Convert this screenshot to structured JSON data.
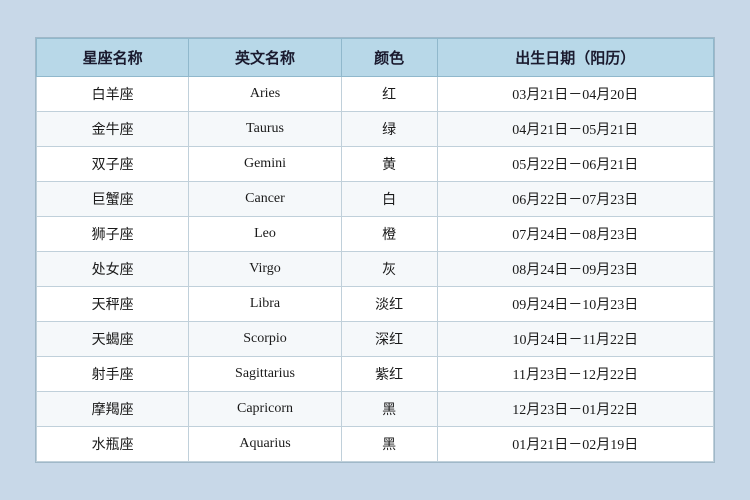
{
  "table": {
    "headers": [
      {
        "key": "chinese_name",
        "label": "星座名称"
      },
      {
        "key": "english_name",
        "label": "英文名称"
      },
      {
        "key": "color",
        "label": "颜色"
      },
      {
        "key": "birthday",
        "label": "出生日期（阳历）"
      }
    ],
    "rows": [
      {
        "chinese_name": "白羊座",
        "english_name": "Aries",
        "color": "红",
        "birthday": "03月21日－04月20日"
      },
      {
        "chinese_name": "金牛座",
        "english_name": "Taurus",
        "color": "绿",
        "birthday": "04月21日－05月21日"
      },
      {
        "chinese_name": "双子座",
        "english_name": "Gemini",
        "color": "黄",
        "birthday": "05月22日－06月21日"
      },
      {
        "chinese_name": "巨蟹座",
        "english_name": "Cancer",
        "color": "白",
        "birthday": "06月22日－07月23日"
      },
      {
        "chinese_name": "狮子座",
        "english_name": "Leo",
        "color": "橙",
        "birthday": "07月24日－08月23日"
      },
      {
        "chinese_name": "处女座",
        "english_name": "Virgo",
        "color": "灰",
        "birthday": "08月24日－09月23日"
      },
      {
        "chinese_name": "天秤座",
        "english_name": "Libra",
        "color": "淡红",
        "birthday": "09月24日－10月23日"
      },
      {
        "chinese_name": "天蝎座",
        "english_name": "Scorpio",
        "color": "深红",
        "birthday": "10月24日－11月22日"
      },
      {
        "chinese_name": "射手座",
        "english_name": "Sagittarius",
        "color": "紫红",
        "birthday": "11月23日－12月22日"
      },
      {
        "chinese_name": "摩羯座",
        "english_name": "Capricorn",
        "color": "黑",
        "birthday": "12月23日－01月22日"
      },
      {
        "chinese_name": "水瓶座",
        "english_name": "Aquarius",
        "color": "黑",
        "birthday": "01月21日－02月19日"
      }
    ]
  }
}
